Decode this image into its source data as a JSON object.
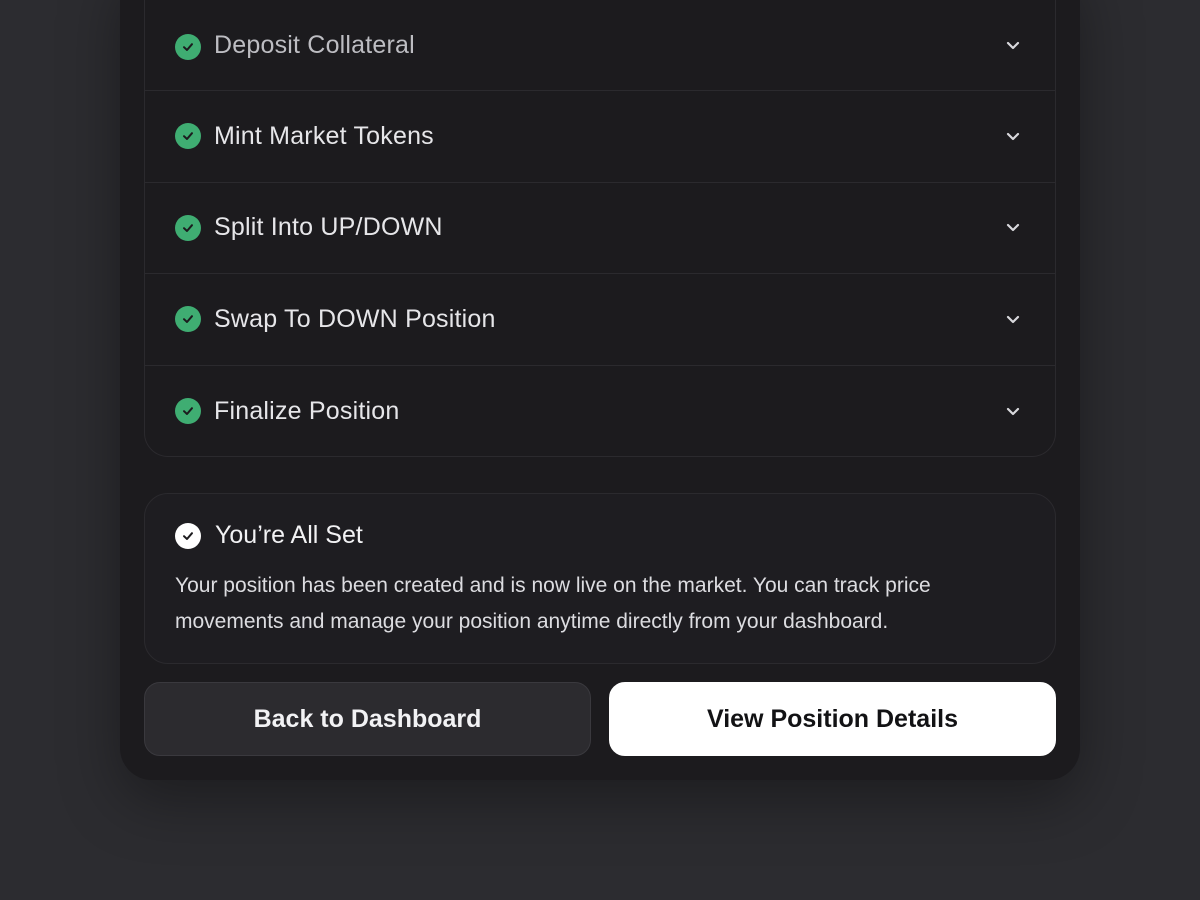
{
  "colors": {
    "success": "#3fad72",
    "card_bg": "#1c1b1e",
    "page_bg": "#2c2c30"
  },
  "steps": [
    {
      "label": "Deposit Collateral",
      "icon": "check-circle-icon",
      "chevron": "chevron-down-icon"
    },
    {
      "label": "Mint Market Tokens",
      "icon": "check-circle-icon",
      "chevron": "chevron-down-icon"
    },
    {
      "label": "Split Into UP/DOWN",
      "icon": "check-circle-icon",
      "chevron": "chevron-down-icon"
    },
    {
      "label": "Swap To DOWN Position",
      "icon": "check-circle-icon",
      "chevron": "chevron-down-icon"
    },
    {
      "label": "Finalize Position",
      "icon": "check-circle-icon",
      "chevron": "chevron-down-icon"
    }
  ],
  "completion": {
    "icon": "check-circle-icon",
    "title": "You’re All Set",
    "message": "Your position has been created and is now live on the market. You can track price movements and manage your position anytime directly from your dashboard."
  },
  "actions": {
    "back_label": "Back to Dashboard",
    "view_label": "View Position Details"
  }
}
